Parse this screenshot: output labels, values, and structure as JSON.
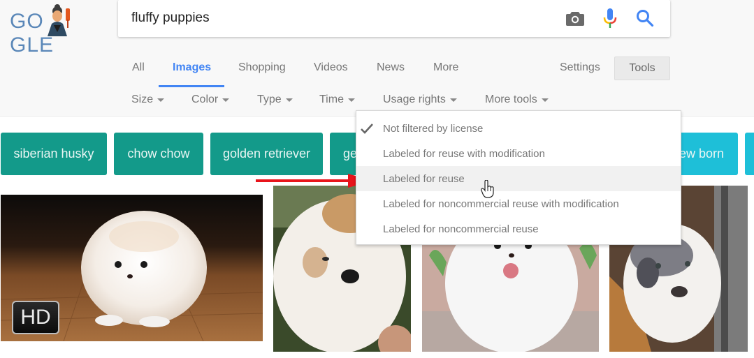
{
  "logo": {
    "text": "GOOGLE",
    "icon": "google-doodle-figure"
  },
  "search": {
    "query": "fluffy puppies",
    "icons": [
      "camera-icon",
      "microphone-icon",
      "search-icon"
    ],
    "colors": {
      "camera": "#6a6a6a",
      "mic_blue": "#4285f4",
      "mic_red": "#ea4335",
      "mic_yellow": "#fbbc05",
      "mic_green": "#34a853",
      "search": "#4285f4"
    }
  },
  "nav": {
    "tabs": [
      {
        "label": "All",
        "active": false
      },
      {
        "label": "Images",
        "active": true
      },
      {
        "label": "Shopping",
        "active": false
      },
      {
        "label": "Videos",
        "active": false
      },
      {
        "label": "News",
        "active": false
      },
      {
        "label": "More",
        "active": false
      }
    ],
    "settings_label": "Settings",
    "tools_label": "Tools",
    "active_color": "#4285f4"
  },
  "filters": [
    {
      "label": "Size"
    },
    {
      "label": "Color"
    },
    {
      "label": "Type"
    },
    {
      "label": "Time"
    },
    {
      "label": "Usage rights"
    },
    {
      "label": "More tools"
    }
  ],
  "chips": [
    {
      "label": "siberian husky",
      "color": "#139a8a"
    },
    {
      "label": "chow chow",
      "color": "#139a8a"
    },
    {
      "label": "golden retriever",
      "color": "#139a8a"
    },
    {
      "label": "ge",
      "color": "#139a8a"
    },
    {
      "label": "ew born",
      "color": "#1ebfd8"
    },
    {
      "label": "",
      "color": "#1ebfd8"
    }
  ],
  "usage_rights_menu": {
    "items": [
      {
        "label": "Not filtered by license",
        "checked": true,
        "hovered": false
      },
      {
        "label": "Labeled for reuse with modification",
        "checked": false,
        "hovered": false
      },
      {
        "label": "Labeled for reuse",
        "checked": false,
        "hovered": true
      },
      {
        "label": "Labeled for noncommercial reuse with modification",
        "checked": false,
        "hovered": false
      },
      {
        "label": "Labeled for noncommercial reuse",
        "checked": false,
        "hovered": false
      }
    ]
  },
  "results": [
    {
      "alt": "white pomeranian puppy on wooden floor",
      "badge": "HD"
    },
    {
      "alt": "white and tan fluffy puppy held in hand",
      "badge": ""
    },
    {
      "alt": "white pomeranian puppy with tongue out",
      "badge": ""
    },
    {
      "alt": "grey and white puppy by a fence",
      "badge": ""
    }
  ],
  "annotation": {
    "arrow_color": "#e8141b",
    "points_to": "Labeled for reuse"
  }
}
